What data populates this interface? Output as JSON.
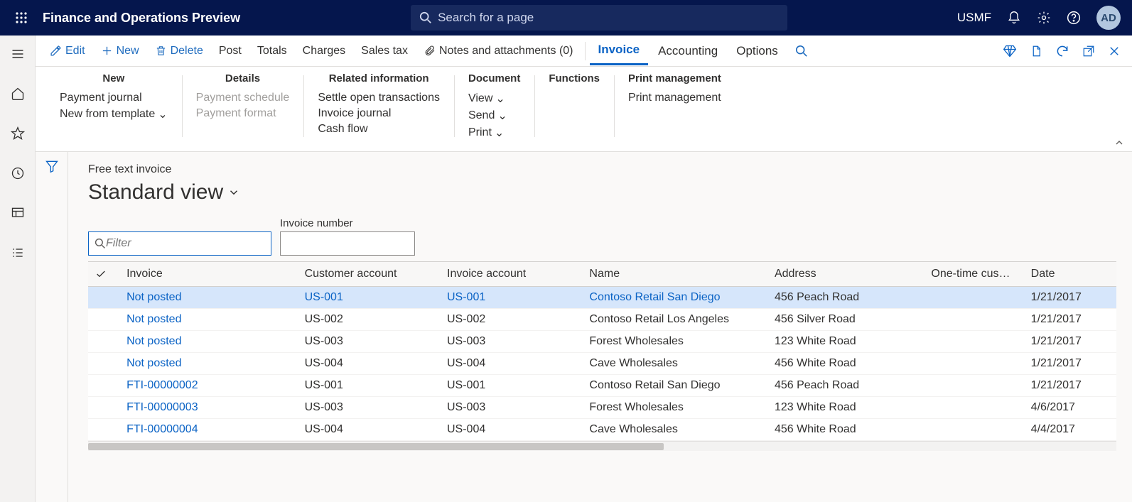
{
  "header": {
    "app_title": "Finance and Operations Preview",
    "search_placeholder": "Search for a page",
    "entity": "USMF",
    "avatar": "AD"
  },
  "actionbar": {
    "edit": "Edit",
    "new": "New",
    "delete": "Delete",
    "post": "Post",
    "totals": "Totals",
    "charges": "Charges",
    "sales_tax": "Sales tax",
    "notes": "Notes and attachments (0)",
    "tabs": {
      "invoice": "Invoice",
      "accounting": "Accounting",
      "options": "Options"
    }
  },
  "ribbon": {
    "new": {
      "title": "New",
      "payment_journal": "Payment journal",
      "new_from_template": "New from template"
    },
    "details": {
      "title": "Details",
      "payment_schedule": "Payment schedule",
      "payment_format": "Payment format"
    },
    "related": {
      "title": "Related information",
      "settle": "Settle open transactions",
      "invoice_journal": "Invoice journal",
      "cash_flow": "Cash flow"
    },
    "document": {
      "title": "Document",
      "view": "View",
      "send": "Send",
      "print": "Print"
    },
    "functions": {
      "title": "Functions"
    },
    "print_mgmt": {
      "title": "Print management",
      "link": "Print management"
    }
  },
  "page": {
    "breadcrumb": "Free text invoice",
    "view_title": "Standard view",
    "filter_placeholder": "Filter",
    "invoice_number_label": "Invoice number"
  },
  "grid": {
    "columns": [
      "Invoice",
      "Customer account",
      "Invoice account",
      "Name",
      "Address",
      "One-time cus…",
      "Date"
    ],
    "rows": [
      {
        "invoice": "Not posted",
        "cust": "US-001",
        "invacct": "US-001",
        "name": "Contoso Retail San Diego",
        "address": "456 Peach Road",
        "onetime": "",
        "date": "1/21/2017",
        "selected": true,
        "linked_cols": [
          0,
          1,
          2,
          3
        ]
      },
      {
        "invoice": "Not posted",
        "cust": "US-002",
        "invacct": "US-002",
        "name": "Contoso Retail Los Angeles",
        "address": "456 Silver Road",
        "onetime": "",
        "date": "1/21/2017",
        "linked_cols": [
          0
        ]
      },
      {
        "invoice": "Not posted",
        "cust": "US-003",
        "invacct": "US-003",
        "name": "Forest Wholesales",
        "address": "123 White Road",
        "onetime": "",
        "date": "1/21/2017",
        "linked_cols": [
          0
        ]
      },
      {
        "invoice": "Not posted",
        "cust": "US-004",
        "invacct": "US-004",
        "name": "Cave Wholesales",
        "address": "456 White Road",
        "onetime": "",
        "date": "1/21/2017",
        "linked_cols": [
          0
        ]
      },
      {
        "invoice": "FTI-00000002",
        "cust": "US-001",
        "invacct": "US-001",
        "name": "Contoso Retail San Diego",
        "address": "456 Peach Road",
        "onetime": "",
        "date": "1/21/2017",
        "linked_cols": [
          0
        ]
      },
      {
        "invoice": "FTI-00000003",
        "cust": "US-003",
        "invacct": "US-003",
        "name": "Forest Wholesales",
        "address": "123 White Road",
        "onetime": "",
        "date": "4/6/2017",
        "linked_cols": [
          0
        ]
      },
      {
        "invoice": "FTI-00000004",
        "cust": "US-004",
        "invacct": "US-004",
        "name": "Cave Wholesales",
        "address": "456 White Road",
        "onetime": "",
        "date": "4/4/2017",
        "linked_cols": [
          0
        ]
      }
    ]
  }
}
